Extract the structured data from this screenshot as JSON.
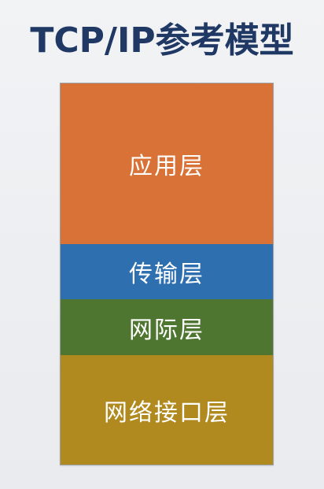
{
  "title": "TCP/IP参考模型",
  "layers": [
    {
      "label": "应用层",
      "color": "#d87236"
    },
    {
      "label": "传输层",
      "color": "#2e6fb0"
    },
    {
      "label": "网际层",
      "color": "#4f7630"
    },
    {
      "label": "网络接口层",
      "color": "#b0891f"
    }
  ]
}
